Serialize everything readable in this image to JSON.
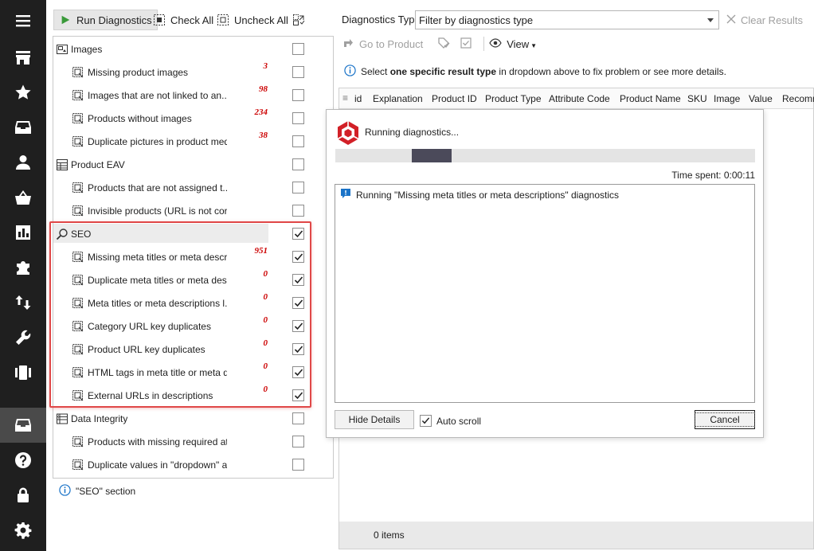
{
  "sidebar": {
    "icons": [
      "menu-icon",
      "store-icon",
      "star-icon",
      "inbox-icon",
      "user-icon",
      "basket-icon",
      "chart-icon",
      "puzzle-icon",
      "sort-arrows-icon",
      "wrench-icon",
      "film-strip-icon",
      "archive-icon",
      "help-icon",
      "lock-icon",
      "settings-icon"
    ],
    "active": "archive-icon"
  },
  "toolbar": {
    "run_label": "Run Diagnostics",
    "check_all_label": "Check All",
    "uncheck_all_label": "Uncheck All"
  },
  "tree": {
    "rows": [
      {
        "label": "Images",
        "count": "",
        "checked": false,
        "level": 0,
        "icon": "images-category-icon"
      },
      {
        "label": "Missing product images",
        "count": "3",
        "checked": false,
        "level": 1,
        "icon": "missing-image-warning-icon"
      },
      {
        "label": "Images that are not linked to an...",
        "count": "98",
        "checked": false,
        "level": 1,
        "icon": "unlinked-image-icon"
      },
      {
        "label": "Products without images",
        "count": "234",
        "checked": false,
        "level": 1,
        "icon": "no-image-icon"
      },
      {
        "label": "Duplicate pictures in product med...",
        "count": "38",
        "checked": false,
        "level": 1,
        "icon": "duplicate-pictures-icon"
      },
      {
        "label": "Product EAV",
        "count": "",
        "checked": false,
        "level": 0,
        "icon": "table-icon"
      },
      {
        "label": "Products that are not assigned t...",
        "count": "",
        "checked": false,
        "level": 1,
        "icon": "unassigned-product-icon"
      },
      {
        "label": "Invisible products (URL is not cor...",
        "count": "",
        "checked": false,
        "level": 1,
        "icon": "invisible-eye-icon"
      },
      {
        "label": "SEO",
        "count": "",
        "checked": true,
        "level": 0,
        "icon": "search-icon"
      },
      {
        "label": "Missing meta titles or meta descri...",
        "count": "951",
        "checked": true,
        "level": 1,
        "icon": "missing-meta-icon"
      },
      {
        "label": "Duplicate meta titles or meta des...",
        "count": "0",
        "checked": true,
        "level": 1,
        "icon": "duplicate-meta-icon"
      },
      {
        "label": "Meta titles or meta descriptions l...",
        "count": "0",
        "checked": true,
        "level": 1,
        "icon": "meta-length-icon"
      },
      {
        "label": "Category URL key duplicates",
        "count": "0",
        "checked": true,
        "level": 1,
        "icon": "category-url-icon"
      },
      {
        "label": "Product URL key duplicates",
        "count": "0",
        "checked": true,
        "level": 1,
        "icon": "product-url-icon"
      },
      {
        "label": "HTML tags in meta title or meta d...",
        "count": "0",
        "checked": true,
        "level": 1,
        "icon": "html-tags-icon"
      },
      {
        "label": "External URLs in descriptions",
        "count": "0",
        "checked": true,
        "level": 1,
        "icon": "external-url-icon"
      },
      {
        "label": "Data Integrity",
        "count": "",
        "checked": false,
        "level": 0,
        "icon": "data-integrity-icon"
      },
      {
        "label": "Products with missing required at...",
        "count": "",
        "checked": false,
        "level": 1,
        "icon": "missing-required-icon"
      },
      {
        "label": "Duplicate values in \"dropdown\" a...",
        "count": "",
        "checked": false,
        "level": 1,
        "icon": "duplicate-values-icon"
      }
    ]
  },
  "section_info": "\"SEO\" section",
  "right": {
    "diag_type_label": "Diagnostics Type",
    "filter_placeholder": "Filter by diagnostics type",
    "clear_results": "Clear Results",
    "go_to_product": "Go to Product",
    "view": "View",
    "info_pre": "Select ",
    "info_bold": "one specific result type",
    "info_post": " in dropdown above to fix problem or see more details.",
    "columns": [
      "id",
      "Explanation",
      "Product ID",
      "Product Type",
      "Attribute Code",
      "Product Name",
      "SKU",
      "Image",
      "Value",
      "Recomm"
    ],
    "items": "0 items"
  },
  "dialog": {
    "title": "Running diagnostics...",
    "progress": 0.095,
    "time_spent": "Time spent: 0:00:11",
    "log_line": "Running \"Missing meta titles or meta descriptions\" diagnostics",
    "hide_details": "Hide Details",
    "auto_scroll": "Auto scroll",
    "auto_scroll_checked": true,
    "cancel": "Cancel"
  },
  "colors": {
    "highlight": "#e04848",
    "count_red": "#cc0000",
    "sidebar_bg": "#1f1f1f",
    "logo_red": "#d22027"
  }
}
